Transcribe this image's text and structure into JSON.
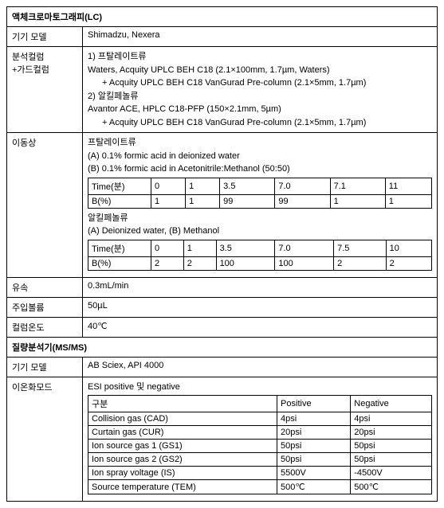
{
  "sections": {
    "lc": "액체크로마토그래피(LC)",
    "ms": "질량분석기(MS/MS)"
  },
  "labels": {
    "instrument": "기기 모델",
    "column": "분석컬럼\n+가드컬럼",
    "mobile": "이동상",
    "flow": "유속",
    "inj": "주입볼륨",
    "coltemp": "컬럼온도",
    "ionmode": "이온화모드"
  },
  "lc_instrument": "Shimadzu, Nexera",
  "column": {
    "h1": "1) 프탈레이트류",
    "l1": "Waters, Acquity UPLC BEH C18 (2.1×100mm, 1.7µm, Waters)",
    "l2": "+ Acquity UPLC BEH C18 VanGurad Pre-column (2.1×5mm, 1.7µm)",
    "h2": "2) 알킬페놀류",
    "l3": "Avantor ACE, HPLC C18-PFP (150×2.1mm, 5µm)",
    "l4": "+ Acquity UPLC BEH C18 VanGurad Pre-column (2.1×5mm, 1.7µm)"
  },
  "mobile": {
    "g1_title": "프탈레이트류",
    "g1_a": "(A) 0.1% formic acid in deionized water",
    "g1_b": "(B) 0.1% formic acid in Acetonitrile:Methanol (50:50)",
    "g2_title": "알킬페놀류",
    "g2_a": "(A) Deionized water, (B) Methanol",
    "row_time": "Time(분)",
    "row_b": "B(%)"
  },
  "chart_data": [
    {
      "type": "table",
      "title": "프탈레이트류 gradient",
      "categories": [
        "0",
        "1",
        "3.5",
        "7.0",
        "7.1",
        "11"
      ],
      "series": [
        {
          "name": "B(%)",
          "values": [
            "1",
            "1",
            "99",
            "99",
            "1",
            "1"
          ]
        }
      ]
    },
    {
      "type": "table",
      "title": "알킬페놀류 gradient",
      "categories": [
        "0",
        "1",
        "3.5",
        "7.0",
        "7.5",
        "10"
      ],
      "series": [
        {
          "name": "B(%)",
          "values": [
            "2",
            "2",
            "100",
            "100",
            "2",
            "2"
          ]
        }
      ]
    }
  ],
  "flow": "0.3mL/min",
  "inj": "50µL",
  "coltemp": "40℃",
  "ms_instrument": "AB Sciex, API 4000",
  "ionmode": "ESI positive 및 negative",
  "ion_table": {
    "h_param": "구분",
    "h_pos": "Positive",
    "h_neg": "Negative",
    "rows": [
      {
        "p": "Collision gas (CAD)",
        "pos": "4psi",
        "neg": "4psi"
      },
      {
        "p": "Curtain gas (CUR)",
        "pos": "20psi",
        "neg": "20psi"
      },
      {
        "p": "Ion source gas 1 (GS1)",
        "pos": "50psi",
        "neg": "50psi"
      },
      {
        "p": "Ion source gas 2 (GS2)",
        "pos": "50psi",
        "neg": "50psi"
      },
      {
        "p": "Ion spray voltage (IS)",
        "pos": "5500V",
        "neg": "-4500V"
      },
      {
        "p": "Source temperature (TEM)",
        "pos": "500℃",
        "neg": "500℃"
      }
    ]
  }
}
